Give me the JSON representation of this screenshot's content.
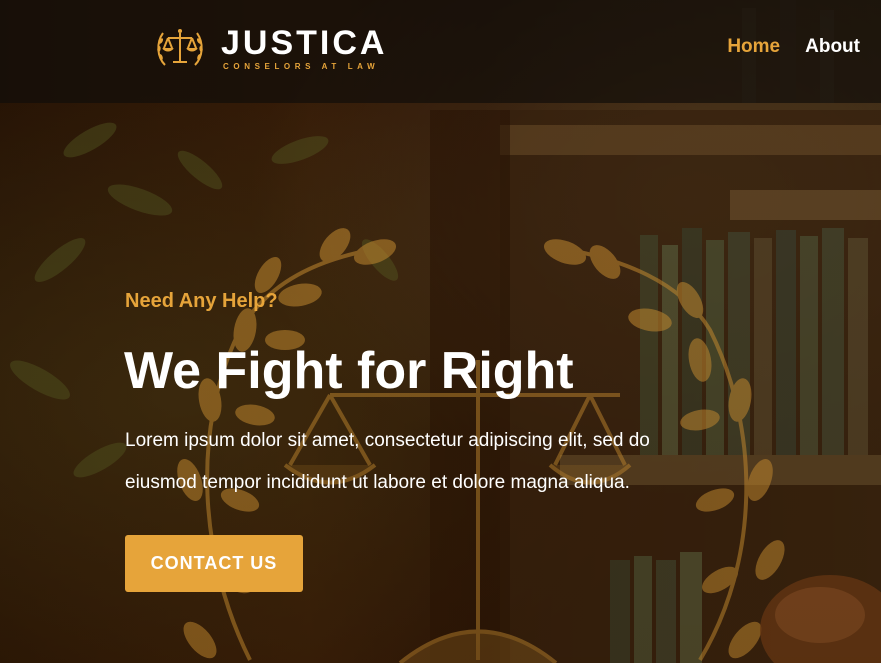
{
  "brand": {
    "name": "JUSTICA",
    "tagline": "CONSELORS AT LAW"
  },
  "nav": {
    "items": [
      {
        "label": "Home",
        "active": true
      },
      {
        "label": "About",
        "active": false
      }
    ]
  },
  "hero": {
    "eyebrow": "Need Any Help?",
    "headline": "We Fight for Right",
    "description": "Lorem ipsum dolor sit amet, consectetur adipiscing elit, sed do eiusmod tempor incididunt ut labore et dolore magna aliqua.",
    "cta_label": "CONTACT US"
  },
  "colors": {
    "accent": "#e6a43a",
    "text": "#ffffff",
    "navbar_bg": "#120e0a"
  }
}
